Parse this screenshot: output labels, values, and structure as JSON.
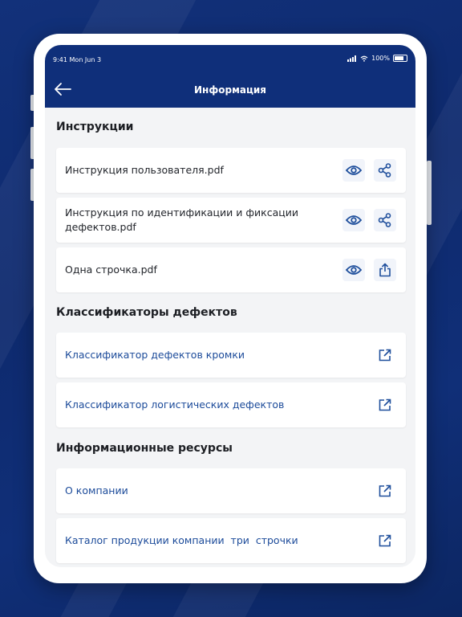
{
  "status_bar": {
    "time": "9:41",
    "date": "Mon Jun 3",
    "battery": "100%"
  },
  "header": {
    "title": "Информация"
  },
  "sections": [
    {
      "title": "Инструкции",
      "items": [
        {
          "label": "Инструкция пользователя.pdf",
          "actions": [
            "eye-icon",
            "share-icon"
          ]
        },
        {
          "label": "Инструкция по идентификации и фиксации дефектов.pdf",
          "actions": [
            "eye-icon",
            "share-icon"
          ]
        },
        {
          "label": "Одна строчка.pdf",
          "actions": [
            "eye-icon",
            "export-icon"
          ]
        }
      ]
    },
    {
      "title": "Классификаторы дефектов",
      "items": [
        {
          "label": "Классификатор дефектов кромки",
          "actions": [
            "external-link-icon"
          ]
        },
        {
          "label": "Классификатор логистических дефектов",
          "actions": [
            "external-link-icon"
          ]
        }
      ]
    },
    {
      "title": "Информационные ресурсы",
      "items": [
        {
          "label": "О компании",
          "actions": [
            "external-link-icon"
          ]
        },
        {
          "label": "Каталог продукции компании  три  строчки",
          "actions": [
            "external-link-icon"
          ]
        }
      ]
    }
  ],
  "colors": {
    "appbar": "#0f2f7a",
    "link": "#1c4b9a",
    "icon": "#1f4f9c"
  }
}
